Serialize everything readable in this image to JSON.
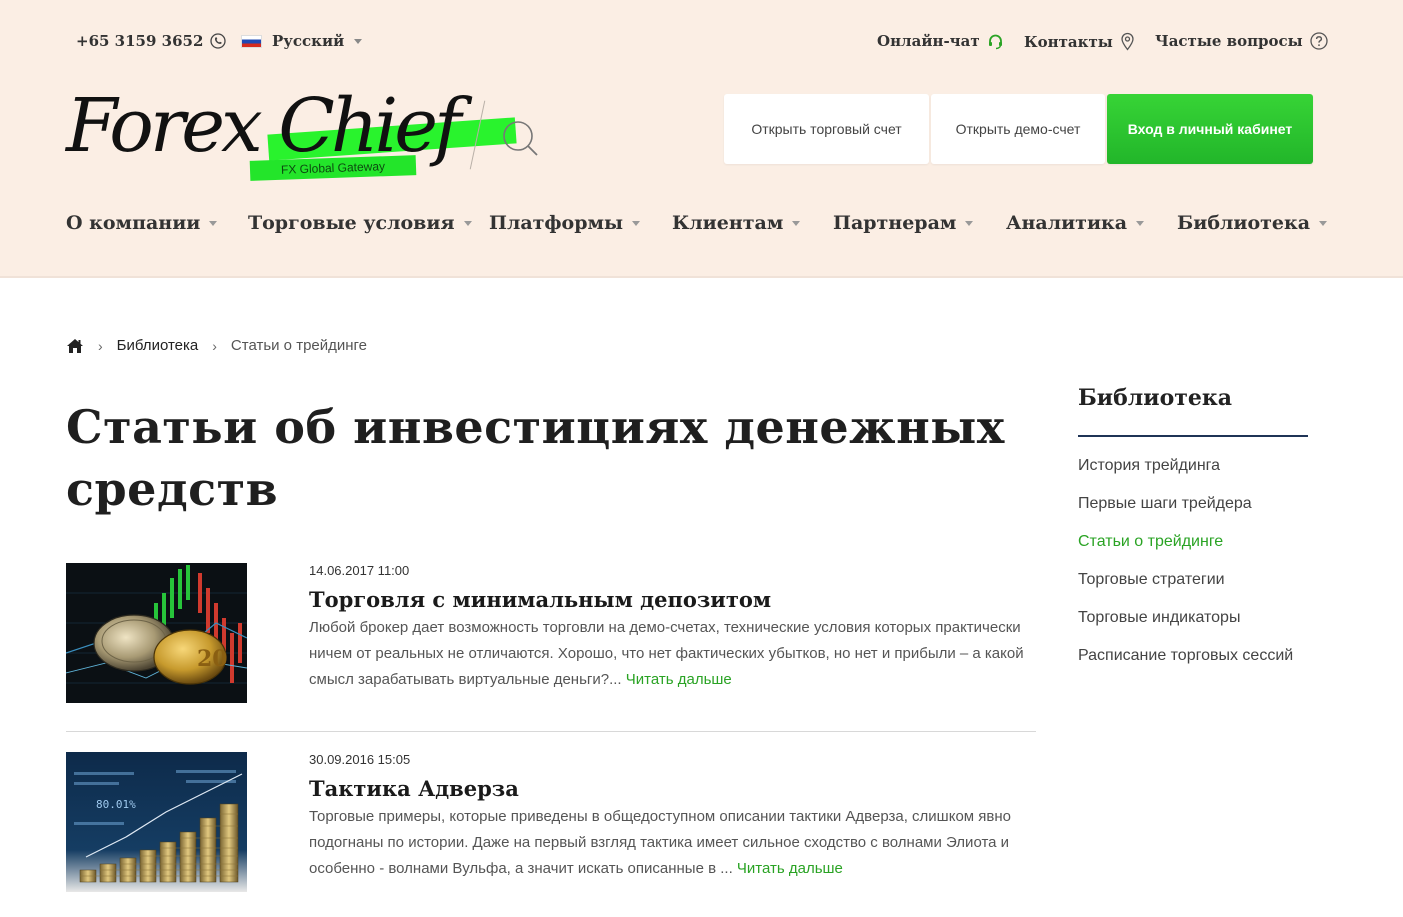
{
  "topbar": {
    "phone": "+65 3159 3652",
    "language": "Русский",
    "chat_label": "Онлайн-чат",
    "contacts_label": "Контакты",
    "faq_label": "Частые вопросы"
  },
  "logo": {
    "text": "Forex Chief",
    "tagline": "FX Global Gateway"
  },
  "header_buttons": {
    "open_account": "Открыть торговый счет",
    "open_demo": "Открыть демо-счет",
    "login": "Вход в личный кабинет"
  },
  "nav": [
    {
      "label": "О компании"
    },
    {
      "label": "Торговые условия"
    },
    {
      "label": "Платформы"
    },
    {
      "label": "Клиентам"
    },
    {
      "label": "Партнерам"
    },
    {
      "label": "Аналитика"
    },
    {
      "label": "Библиотека"
    }
  ],
  "breadcrumb": {
    "sep": "›",
    "library": "Библиотека",
    "current": "Статьи о трейдинге"
  },
  "page_title": "Статьи об инвестициях денежных средств",
  "articles": [
    {
      "date": "14.06.2017 11:00",
      "title": "Торговля с минимальным депозитом",
      "excerpt": "Любой брокер дает возможность торговли на демо-счетах, технические условия которых практически ничем от реальных не отличаются. Хорошо, что нет фактических убытков, но нет и прибыли – а какой смысл зарабатывать виртуальные деньги?...",
      "read_more": "Читать дальше",
      "coin_label": "20"
    },
    {
      "date": "30.09.2016 15:05",
      "title": "Тактика Адверза",
      "excerpt": "Торговые примеры, которые приведены в общедоступном описании тактики Адверза, слишком явно подогнаны по истории. Даже на первый взгляд тактика имеет сильное сходство с волнами Элиота и особенно - волнами Вульфа, а значит искать описанные в ...",
      "read_more": "Читать дальше",
      "screen_label": "80.01%"
    }
  ],
  "sidebar": {
    "title": "Библиотека",
    "items": [
      {
        "label": "История трейдинга"
      },
      {
        "label": "Первые шаги трейдера"
      },
      {
        "label": "Статьи о трейдинге"
      },
      {
        "label": "Торговые стратегии"
      },
      {
        "label": "Торговые индикаторы"
      },
      {
        "label": "Расписание торговых сессий"
      }
    ],
    "active_index": 2
  },
  "colors": {
    "header_bg": "#fbeee4",
    "accent_green": "#2aa324",
    "login_button": "#2cc330",
    "sidebar_rule": "#1f3456"
  }
}
